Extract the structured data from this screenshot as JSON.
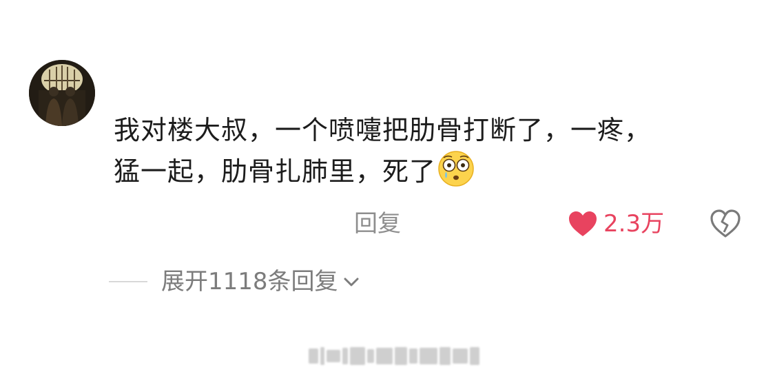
{
  "comment": {
    "text_line1": "我对楼大叔，一个喷嚏把肋骨打断了，一疼，",
    "text_line2": "猛一起，肋骨扎肺里，死了",
    "emoji": "flushed-tear-emoji"
  },
  "actions": {
    "reply_label": "回复",
    "like_count": "2.3万",
    "like_icon": "heart-icon",
    "dislike_icon": "broken-heart-icon"
  },
  "replies": {
    "expand_label": "展开1118条回复",
    "chevron_icon": "chevron-down-icon"
  },
  "colors": {
    "like_red": "#e8435f",
    "text_main": "#1c1c1c",
    "text_muted": "#8e8e8e"
  }
}
